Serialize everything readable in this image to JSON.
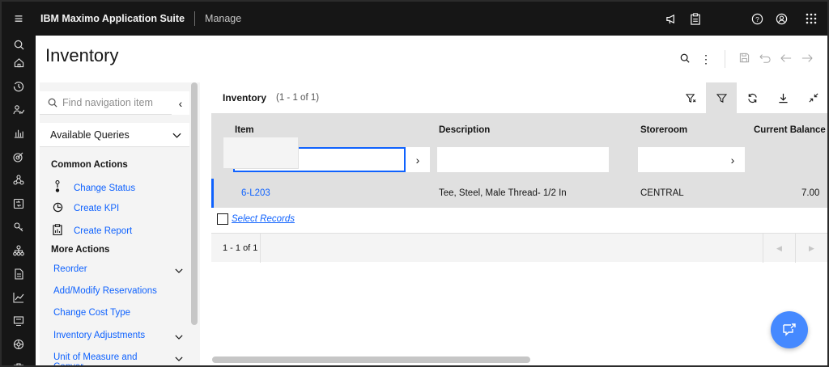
{
  "topbar": {
    "brand": "IBM Maximo Application Suite",
    "app": "Manage",
    "icons": [
      "menu-icon",
      "megaphone-icon",
      "clipboard-icon",
      "help-icon",
      "user-icon",
      "app-switcher-icon"
    ]
  },
  "rail": {
    "icons": [
      "search-icon",
      "home-icon",
      "recent-icon",
      "people-icon",
      "chart-icon",
      "target-icon",
      "network-icon",
      "workflow-icon",
      "key-icon",
      "hierarchy-icon",
      "document-icon",
      "analytics-icon",
      "screen-icon",
      "gear-icon",
      "briefcase-icon"
    ]
  },
  "page": {
    "title": "Inventory"
  },
  "nav": {
    "search_placeholder": "Find navigation item",
    "queries_label": "Available Queries",
    "common_heading": "Common Actions",
    "common_actions": [
      {
        "label": "Change Status",
        "icon": "status-icon"
      },
      {
        "label": "Create KPI",
        "icon": "kpi-icon"
      },
      {
        "label": "Create Report",
        "icon": "report-icon"
      }
    ],
    "more_heading": "More Actions",
    "more_actions": [
      {
        "label": "Reorder",
        "expandable": true
      },
      {
        "label": "Add/Modify Reservations",
        "expandable": false
      },
      {
        "label": "Change Cost Type",
        "expandable": false
      },
      {
        "label": "Inventory Adjustments",
        "expandable": true
      },
      {
        "label": "Unit of Measure and Conver...",
        "expandable": true
      }
    ]
  },
  "table": {
    "title": "Inventory",
    "count": "(1 - 1 of 1)",
    "columns": [
      "Item",
      "Description",
      "Storeroom",
      "Current Balance"
    ],
    "rows": [
      {
        "item": "6-L203",
        "description": "Tee, Steel, Male Thread- 1/2 In",
        "storeroom": "CENTRAL",
        "balance": "7.00"
      }
    ],
    "select_records": "Select Records",
    "pager_text": "1 - 1 of 1",
    "tools": [
      "clear-filter-icon",
      "filter-icon",
      "refresh-icon",
      "download-icon",
      "collapse-icon"
    ]
  },
  "colors": {
    "accent": "#0f62fe",
    "topbar": "#161616",
    "header_bg": "#e0e0e0",
    "fab": "#4589ff"
  }
}
